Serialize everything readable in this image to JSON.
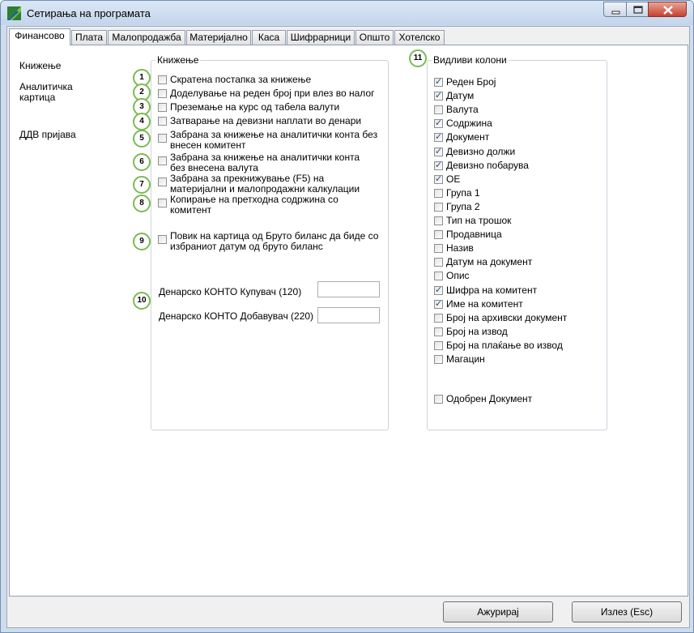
{
  "window": {
    "title": "Сетирања на програмата"
  },
  "tabs": [
    {
      "label": "Финансово",
      "active": true
    },
    {
      "label": "Плата"
    },
    {
      "label": "Малопродажба"
    },
    {
      "label": "Материјално"
    },
    {
      "label": "Каса"
    },
    {
      "label": "Шифрарници"
    },
    {
      "label": "Општо"
    },
    {
      "label": "Хотелско"
    }
  ],
  "nav": {
    "knizenje": "Книжење",
    "analiticka_1": "Аналитичка",
    "analiticka_2": "картица",
    "ddv": "ДДВ пријава"
  },
  "knizenje_group": {
    "title": "Книжење",
    "options": [
      {
        "badge": "1",
        "line1": "Скратена постапка за книжење",
        "line2": "",
        "checked": false
      },
      {
        "badge": "2",
        "line1": "Доделување на реден број при влез во налог",
        "line2": "",
        "checked": false
      },
      {
        "badge": "3",
        "line1": "Преземање на курс од табела валути",
        "line2": "",
        "checked": false
      },
      {
        "badge": "4",
        "line1": "Затварање на девизни наплати во денари",
        "line2": "",
        "checked": false
      },
      {
        "badge": "5",
        "line1": "Забрана за книжење на аналитички конта без",
        "line2": "внесен комитент",
        "checked": false
      },
      {
        "badge": "6",
        "line1": "Забрана за книжење на аналитички конта",
        "line2": "без внесена валута",
        "checked": false
      },
      {
        "badge": "7",
        "line1": "Забрана за прекнижување (F5) на",
        "line2": "материјални и малопродажни калкулации",
        "checked": false
      },
      {
        "badge": "8",
        "line1": "Копирање на претходна содржина со",
        "line2": "комитент",
        "checked": false
      },
      {
        "badge": "9",
        "line1": "Повик на картица од Бруто биланс да биде со",
        "line2": "избраниот датум од бруто биланс",
        "checked": false
      }
    ],
    "badge10": "10",
    "konto_kupuvac_label": "Денарско КОНТО Купувач (120)",
    "konto_kupuvac_value": "",
    "konto_dobavuvac_label": "Денарско КОНТО Добавувач (220)",
    "konto_dobavuvac_value": ""
  },
  "columns_group": {
    "title": "Видливи колони",
    "badge": "11",
    "columns": [
      {
        "label": "Реден Број",
        "checked": true
      },
      {
        "label": "Датум",
        "checked": true
      },
      {
        "label": "Валута",
        "checked": false
      },
      {
        "label": "Содржина",
        "checked": true
      },
      {
        "label": "Документ",
        "checked": true
      },
      {
        "label": "Девизно должи",
        "checked": true
      },
      {
        "label": "Девизно побарува",
        "checked": true
      },
      {
        "label": "ОЕ",
        "checked": true
      },
      {
        "label": "Група 1",
        "checked": false
      },
      {
        "label": "Група 2",
        "checked": false
      },
      {
        "label": "Тип на трошок",
        "checked": false
      },
      {
        "label": "Продавница",
        "checked": false
      },
      {
        "label": "Назив",
        "checked": false
      },
      {
        "label": "Датум на документ",
        "checked": false
      },
      {
        "label": "Опис",
        "checked": false
      },
      {
        "label": "Шифра на комитент",
        "checked": true
      },
      {
        "label": "Име на комитент",
        "checked": true
      },
      {
        "label": "Број на архивски документ",
        "checked": false
      },
      {
        "label": "Број на извод",
        "checked": false
      },
      {
        "label": "Број на плаќање во извод",
        "checked": false
      },
      {
        "label": "Магацин",
        "checked": false
      }
    ],
    "approved": {
      "label": "Одобрен Документ",
      "checked": false
    }
  },
  "buttons": {
    "update": "Ажурирај",
    "exit": "Излез (Esc)"
  },
  "icons": {
    "app": "app-logo-icon",
    "minimize": "minimize-icon",
    "maximize": "maximize-icon",
    "close": "close-icon"
  }
}
